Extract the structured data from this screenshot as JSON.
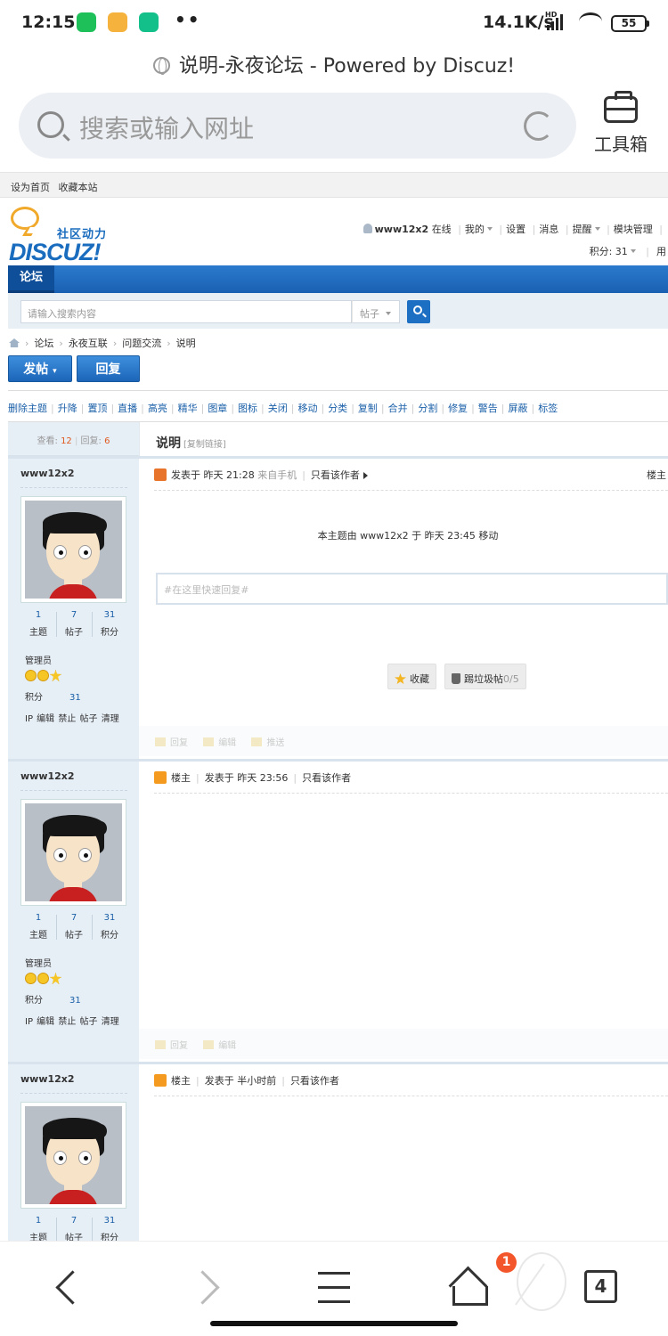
{
  "status_bar": {
    "time": "12:15",
    "speed": "14.1K/s",
    "network": "HD",
    "battery": "55"
  },
  "browser": {
    "page_title": "说明-永夜论坛 - Powered by Discuz!",
    "search_placeholder": "搜索或输入网址",
    "toolbox_label": "工具箱",
    "tabs_count": "4",
    "notification_badge": "1"
  },
  "forum": {
    "topbar": {
      "set_home": "设为首页",
      "bookmark": "收藏本站"
    },
    "logo": {
      "slogan": "社区动力",
      "brand": "DISCUZ!"
    },
    "userbar": {
      "username": "www12x2",
      "online": "在线",
      "items": [
        "我的",
        "设置",
        "消息",
        "提醒",
        "模块管理"
      ],
      "credits": "积分: 31",
      "extra": "用"
    },
    "nav": {
      "tab": "论坛"
    },
    "search": {
      "placeholder": "请输入搜索内容",
      "type": "帖子"
    },
    "breadcrumb": [
      "论坛",
      "永夜互联",
      "问题交流",
      "说明"
    ],
    "buttons": {
      "post": "发帖",
      "reply": "回复"
    },
    "mod_actions": [
      "删除主题",
      "升降",
      "置顶",
      "直播",
      "高亮",
      "精华",
      "图章",
      "图标",
      "关闭",
      "移动",
      "分类",
      "复制",
      "合并",
      "分割",
      "修复",
      "警告",
      "屏蔽",
      "标签"
    ],
    "thread": {
      "views_label": "查看:",
      "views": "12",
      "replies_label": "回复:",
      "replies": "6",
      "title": "说明",
      "copy_link": "[复制链接]"
    },
    "posts": [
      {
        "author": "www12x2",
        "stats": [
          {
            "v": "1",
            "l": "主题"
          },
          {
            "v": "7",
            "l": "帖子"
          },
          {
            "v": "31",
            "l": "积分"
          }
        ],
        "group": "管理员",
        "credit_label": "积分",
        "credit": "31",
        "admin_links": "IP 编辑 禁止 帖子 清理",
        "info": {
          "posted": "发表于 昨天 21:28",
          "source": "来自手机",
          "only_author": "只看该作者",
          "floor": "楼主"
        },
        "moved_notice": "本主题由 www12x2 于 昨天 23:45 移动",
        "quick_reply": "#在这里快速回复#",
        "fav": "收藏",
        "trash": "踢垃圾帖",
        "trash_count": "0/5",
        "footer": [
          "回复",
          "编辑",
          "推送"
        ]
      },
      {
        "author": "www12x2",
        "stats": [
          {
            "v": "1",
            "l": "主题"
          },
          {
            "v": "7",
            "l": "帖子"
          },
          {
            "v": "31",
            "l": "积分"
          }
        ],
        "group": "管理员",
        "credit_label": "积分",
        "credit": "31",
        "admin_links": "IP 编辑 禁止 帖子 清理",
        "info": {
          "role": "楼主",
          "posted": "发表于 昨天 23:56",
          "only_author": "只看该作者"
        },
        "footer": [
          "回复",
          "编辑"
        ]
      },
      {
        "author": "www12x2",
        "stats": [
          {
            "v": "1",
            "l": "主题"
          },
          {
            "v": "7",
            "l": "帖子"
          },
          {
            "v": "31",
            "l": "积分"
          }
        ],
        "info": {
          "role": "楼主",
          "posted": "发表于 半小时前",
          "only_author": "只看该作者"
        }
      }
    ]
  }
}
